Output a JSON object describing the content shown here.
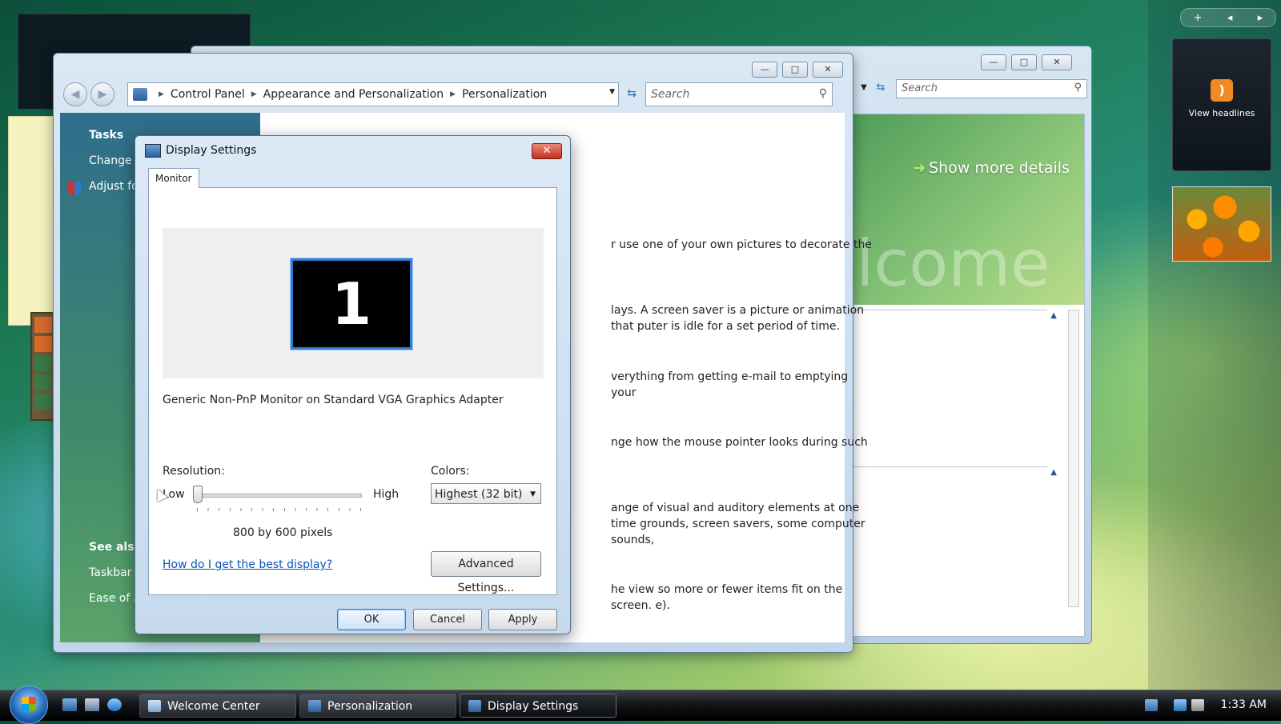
{
  "colors": {
    "link": "#0a55b0",
    "selection_border": "#2f7fd6",
    "close_button": "#c2301c",
    "rss_orange": "#f08a24"
  },
  "sidebar": {
    "controls": [
      "+",
      "◂",
      "▸"
    ],
    "rss_gadget_label": "View headlines",
    "rss_icon": "rss-icon"
  },
  "welcome_window": {
    "search_placeholder": "Search",
    "show_more_details": "Show more details",
    "banner_text": "elcome",
    "minimize": "—",
    "maximize": "□",
    "close": "✕"
  },
  "personalization_window": {
    "breadcrumb": [
      "Control Panel",
      "Appearance and Personalization",
      "Personalization"
    ],
    "search_placeholder": "Search",
    "minimize": "—",
    "maximize": "□",
    "close": "✕",
    "left_pane": {
      "tasks_heading": "Tasks",
      "task_change": "Change",
      "task_adjust": "Adjust fo",
      "see_also_heading": "See also",
      "see_also_taskbar": "Taskbar",
      "see_also_ease": "Ease of A"
    },
    "main_fragments": [
      "r use one of your own pictures to decorate the",
      "lays. A screen saver is a picture or animation that puter is idle for a set period of time.",
      "verything from getting e-mail to emptying your",
      "nge how the mouse pointer looks during such",
      "ange of visual and auditory elements at one time grounds, screen savers, some computer sounds,",
      "he view so more or fewer items fit on the screen. e)."
    ]
  },
  "display_settings": {
    "title": "Display Settings",
    "close": "✕",
    "tab_monitor": "Monitor",
    "monitor_number": "1",
    "monitor_name": "Generic Non-PnP Monitor on Standard VGA Graphics Adapter",
    "resolution_label": "Resolution:",
    "low_label": "Low",
    "high_label": "High",
    "resolution_value": "800 by 600 pixels",
    "resolution_slider_position": 0,
    "colors_label": "Colors:",
    "colors_selected": "Highest (32 bit)",
    "help_link": "How do I get the best display?",
    "advanced_button": "Advanced Settings...",
    "ok_button": "OK",
    "cancel_button": "Cancel",
    "apply_button": "Apply"
  },
  "taskbar": {
    "buttons": [
      "Welcome Center",
      "Personalization",
      "Display Settings"
    ],
    "active_button": "Display Settings",
    "clock": "1:33 AM"
  }
}
